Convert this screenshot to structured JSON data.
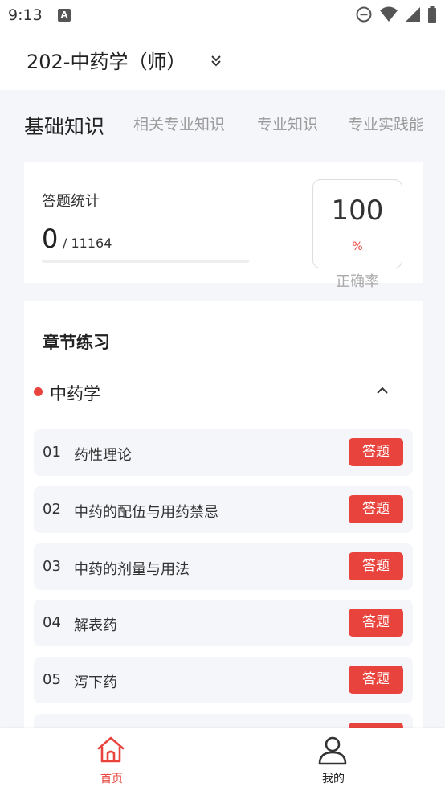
{
  "status_bar": {
    "time": "9:13",
    "notification_badge": "A",
    "icons": [
      "do-not-disturb-icon",
      "wifi-icon",
      "signal-icon",
      "battery-icon"
    ]
  },
  "header": {
    "title": "202-中药学（师）"
  },
  "tabs": [
    {
      "label": "基础知识",
      "active": true
    },
    {
      "label": "相关专业知识",
      "active": false
    },
    {
      "label": "专业知识",
      "active": false
    },
    {
      "label": "专业实践能",
      "active": false
    }
  ],
  "stats": {
    "label": "答题统计",
    "answered": "0",
    "total": "/ 11164",
    "progress": 0,
    "accuracy_value": "100",
    "accuracy_unit": "%",
    "accuracy_label": "正确率"
  },
  "chapters": {
    "title": "章节练习",
    "subject": "中药学",
    "items": [
      {
        "num": "01",
        "name": "药性理论",
        "button": "答题"
      },
      {
        "num": "02",
        "name": "中药的配伍与用药禁忌",
        "button": "答题"
      },
      {
        "num": "03",
        "name": "中药的剂量与用法",
        "button": "答题"
      },
      {
        "num": "04",
        "name": "解表药",
        "button": "答题"
      },
      {
        "num": "05",
        "name": "泻下药",
        "button": "答题"
      }
    ]
  },
  "bottom_nav": [
    {
      "label": "首页",
      "icon": "home-icon",
      "active": true
    },
    {
      "label": "我的",
      "icon": "user-icon",
      "active": false
    }
  ],
  "colors": {
    "accent": "#e8443d",
    "background": "#f5f6fa",
    "inactive_text": "#999999"
  }
}
